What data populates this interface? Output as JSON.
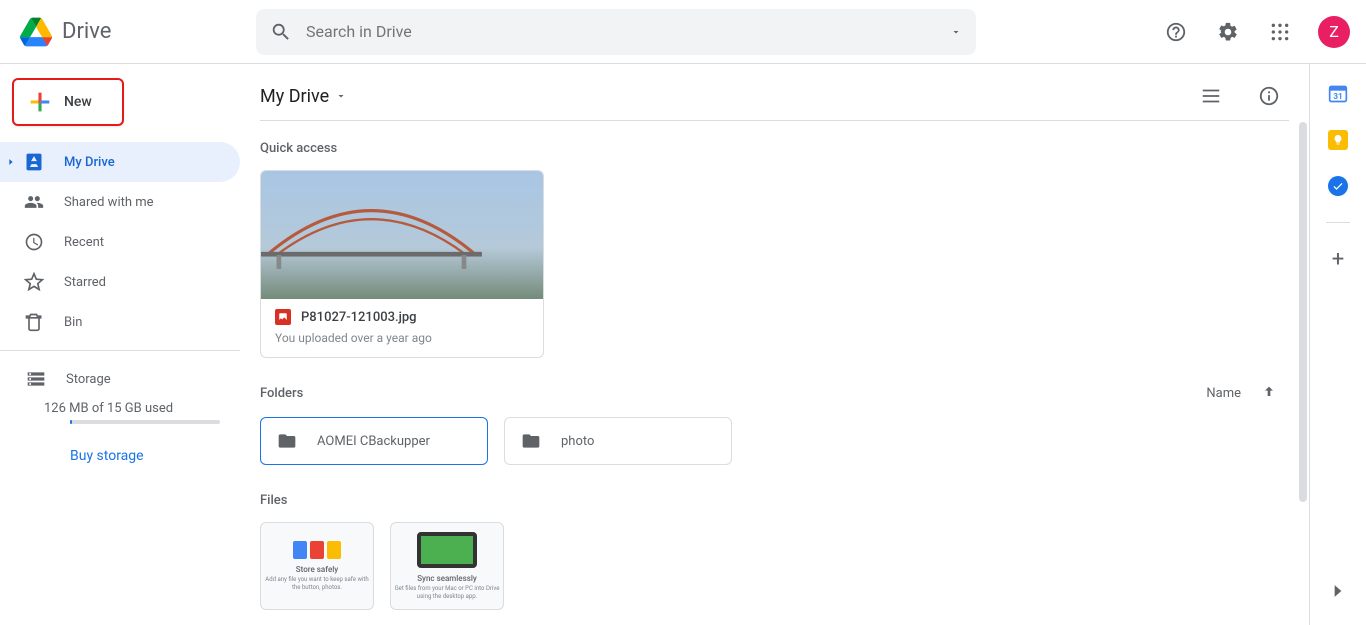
{
  "header": {
    "appName": "Drive",
    "searchPlaceholder": "Search in Drive",
    "avatarInitial": "Z"
  },
  "sidebar": {
    "newLabel": "New",
    "items": [
      {
        "label": "My Drive"
      },
      {
        "label": "Shared with me"
      },
      {
        "label": "Recent"
      },
      {
        "label": "Starred"
      },
      {
        "label": "Bin"
      }
    ],
    "storageLabel": "Storage",
    "storageUsed": "126 MB of 15 GB used",
    "buyLabel": "Buy storage"
  },
  "main": {
    "breadcrumb": "My Drive",
    "quickAccessTitle": "Quick access",
    "quickAccess": {
      "fileName": "P81027-121003.jpg",
      "subtitle": "You uploaded over a year ago"
    },
    "foldersTitle": "Folders",
    "sortLabel": "Name",
    "folders": [
      {
        "name": "AOMEI CBackupper"
      },
      {
        "name": "photo"
      }
    ],
    "filesTitle": "Files",
    "file1": {
      "title": "Store safely",
      "sub": "Add any file you want to keep safe with the button, photos."
    },
    "file2": {
      "title": "Sync seamlessly",
      "sub": "Get files from your Mac or PC into Drive using the desktop app."
    }
  }
}
